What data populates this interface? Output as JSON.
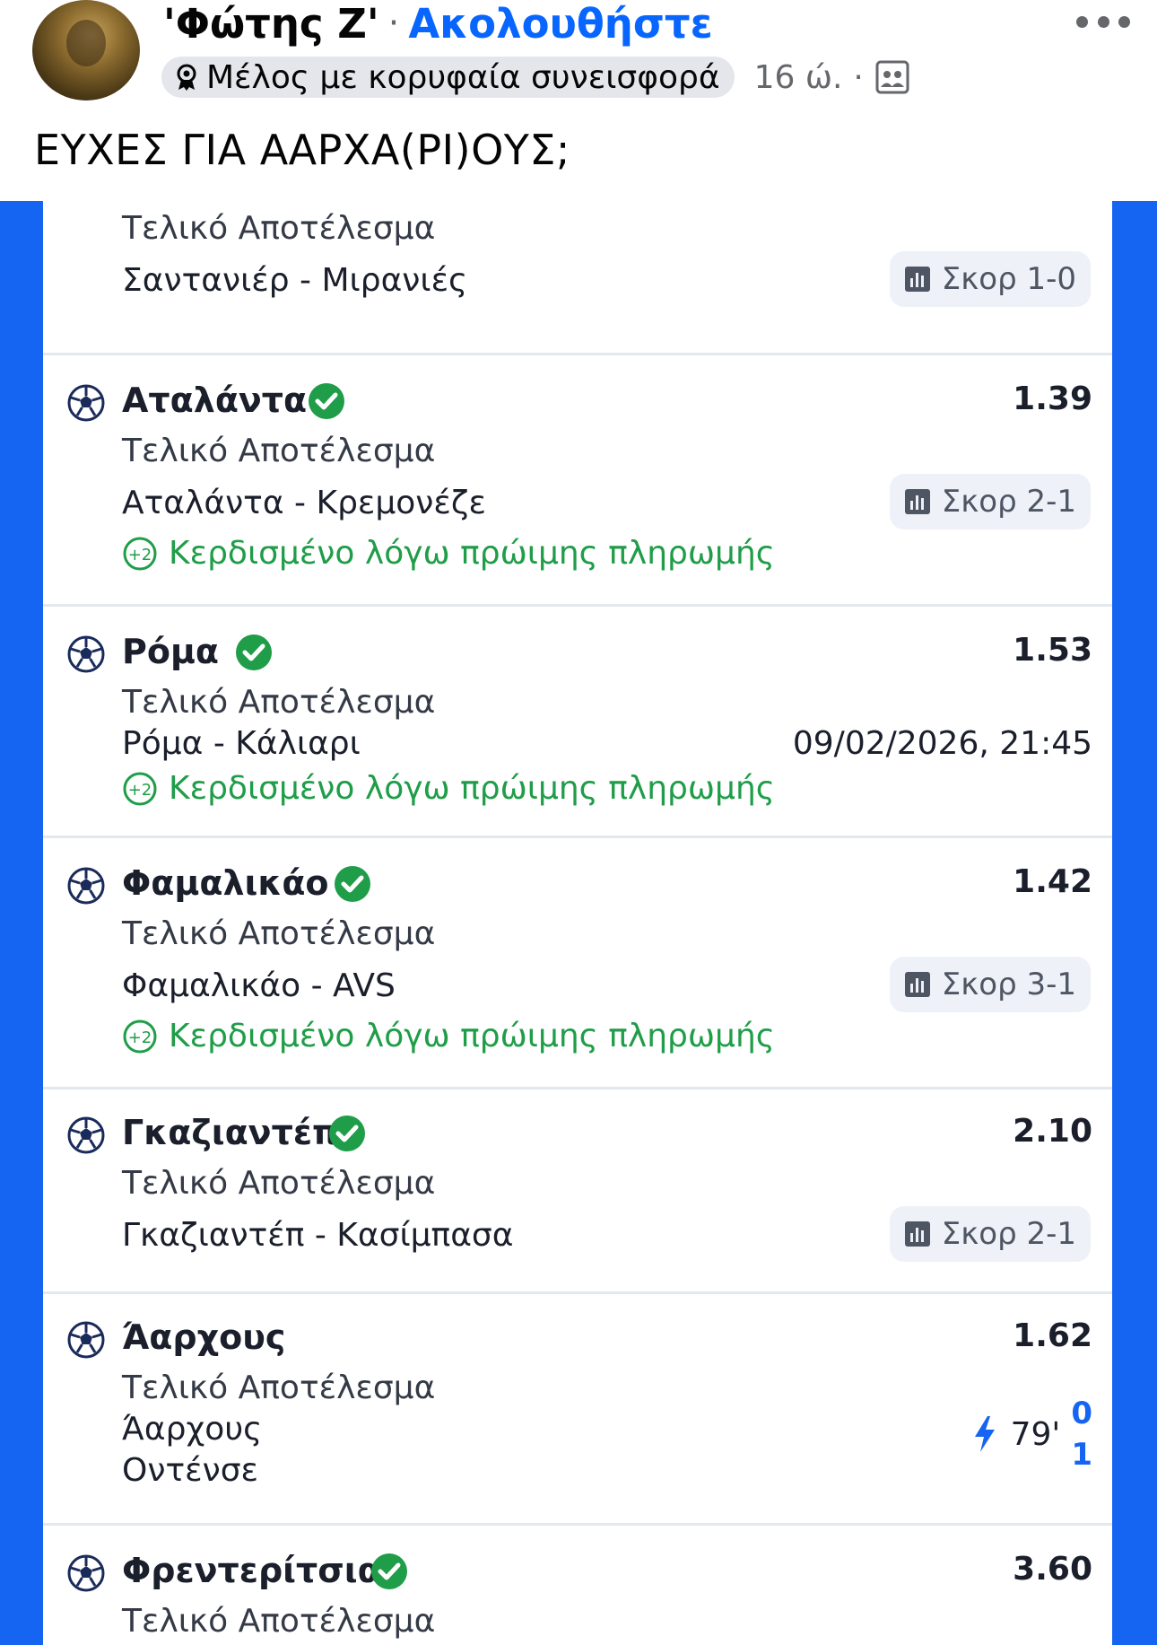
{
  "post": {
    "author_name": "'Φώτης Ζ'",
    "separator": "·",
    "follow_label": "Ακολουθήστε",
    "badge_label": "Μέλος με κορυφαία συνεισφορά",
    "time": "16 ώ.",
    "meta_separator": "·",
    "text": "ΕΥΧΕΣ ΓΙΑ ΑΑΡΧΑ(ΡΙ)ΟΥΣ;"
  },
  "slip": {
    "accent_color": "#1565f2",
    "win_color": "#1f9d48",
    "top_row": {
      "market": "Τελικό Αποτέλεσμα",
      "match": "Σαντανιέρ - Μιρανιές",
      "score": "Σκορ 1-0"
    },
    "bets": [
      {
        "team": "Αταλάντα",
        "odds": "1.39",
        "market": "Τελικό Αποτέλεσμα",
        "match": "Αταλάντα - Κρεμονέζε",
        "score": "Σκορ 2-1",
        "note": "Κερδισμένο λόγω πρώιμης πληρωμής"
      },
      {
        "team": "Ρόμα",
        "odds": "1.53",
        "market": "Τελικό Αποτέλεσμα",
        "match": "Ρόμα - Κάλιαρι",
        "datetime": "09/02/2026, 21:45",
        "note": "Κερδισμένο λόγω πρώιμης πληρωμής"
      },
      {
        "team": "Φαμαλικάο",
        "odds": "1.42",
        "market": "Τελικό Αποτέλεσμα",
        "match": "Φαμαλικάο - AVS",
        "score": "Σκορ 3-1",
        "note": "Κερδισμένο λόγω πρώιμης πληρωμής"
      },
      {
        "team": "Γκαζιαντέπ",
        "odds": "2.10",
        "market": "Τελικό Αποτέλεσμα",
        "match": "Γκαζιαντέπ - Κασίμπασα",
        "score": "Σκορ 2-1"
      },
      {
        "team": "Άαρχους",
        "odds": "1.62",
        "market": "Τελικό Αποτέλεσμα",
        "home": "Άαρχους",
        "away": "Οντένσε",
        "minute": "79'",
        "home_score": "0",
        "away_score": "1"
      },
      {
        "team": "Φρεντερίτσια",
        "odds": "3.60",
        "market": "Τελικό Αποτέλεσμα"
      }
    ]
  }
}
